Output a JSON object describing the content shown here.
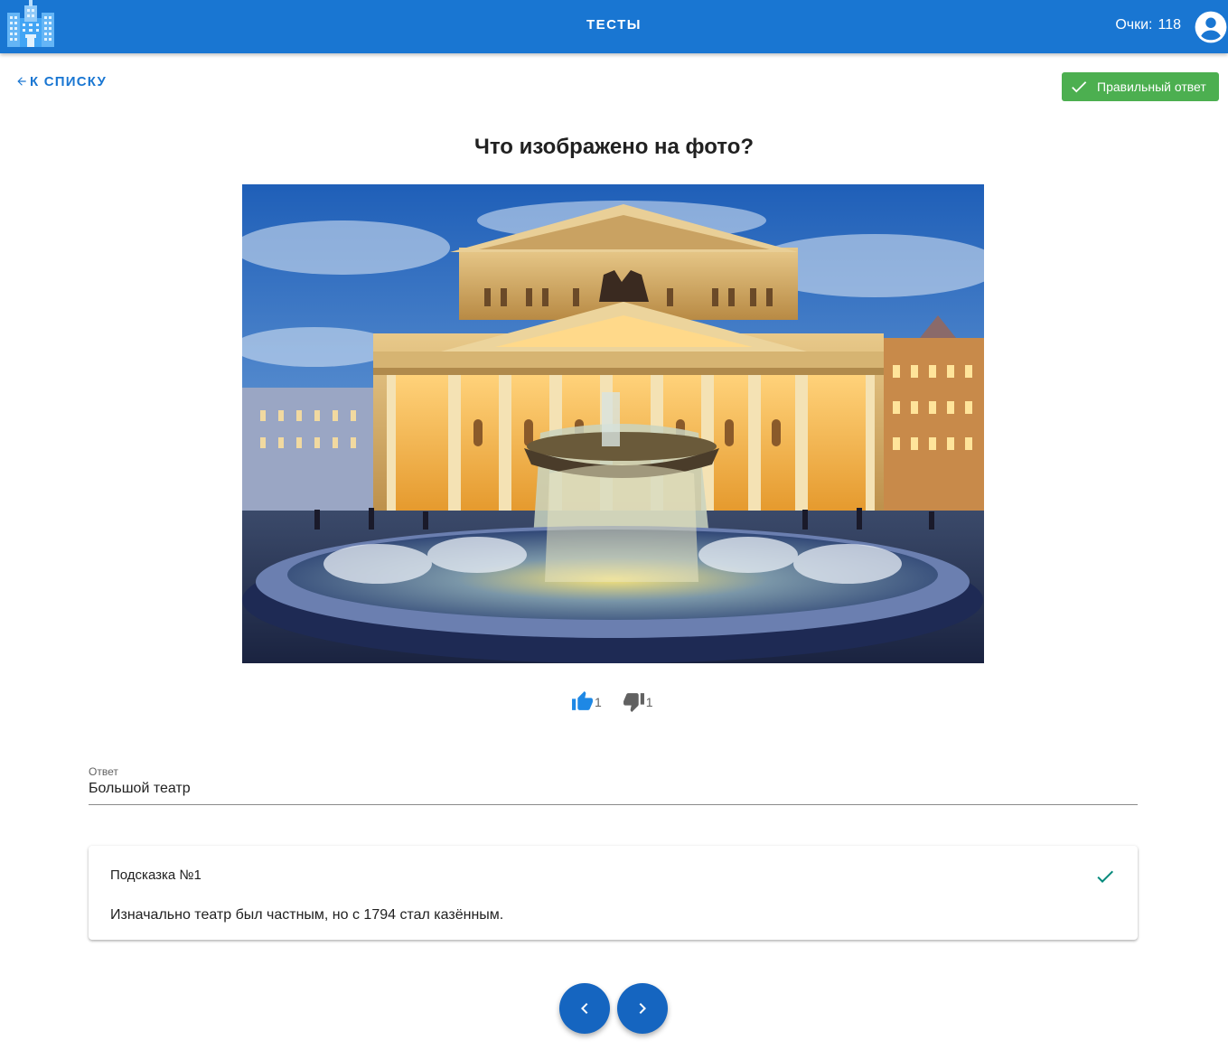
{
  "header": {
    "title": "ТЕСТЫ",
    "score_label": "Очки:",
    "score_value": "118",
    "logo_icon": "city-buildings-logo",
    "account_icon": "account-circle-icon"
  },
  "back_link": {
    "label": "К СПИСКУ",
    "icon": "arrow-left-icon"
  },
  "status_badge": {
    "label": "Правильный ответ",
    "icon": "check-icon",
    "color": "#4caf50"
  },
  "question": {
    "title": "Что изображено на фото?"
  },
  "photo": {
    "subject": "Bolshoi Theatre with illuminated fountain at dusk"
  },
  "votes": {
    "likes": "1",
    "dislikes": "1",
    "like_icon": "thumb-up-icon",
    "dislike_icon": "thumb-down-icon"
  },
  "answer": {
    "label": "Ответ",
    "value": "Большой театр"
  },
  "hint": {
    "title": "Подсказка №1",
    "text": "Изначально театр был частным, но с 1794 стал казённым.",
    "icon": "check-icon",
    "icon_color": "#00897b"
  },
  "navigation": {
    "prev_icon": "chevron-left-icon",
    "next_icon": "chevron-right-icon"
  },
  "colors": {
    "primary": "#1976d2",
    "fab": "#1565c0",
    "success": "#4caf50"
  }
}
